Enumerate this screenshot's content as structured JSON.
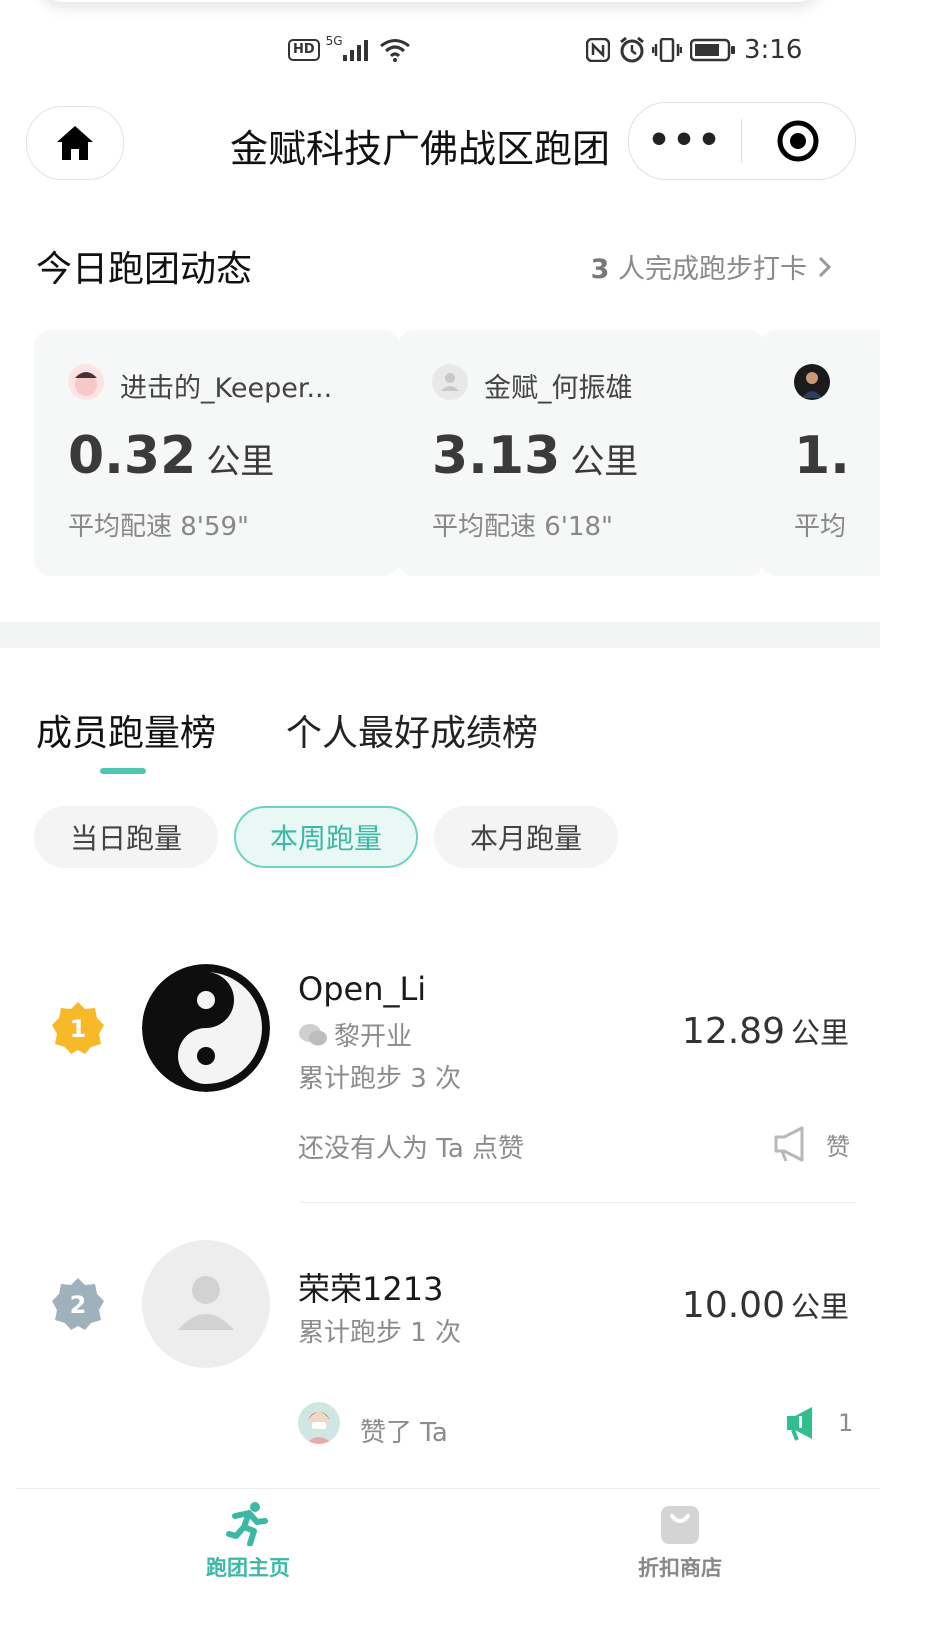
{
  "status_bar": {
    "network": "5G",
    "hd": "HD",
    "time": "3:16"
  },
  "nav": {
    "title": "金赋科技广佛战区跑团",
    "more_label": "•••"
  },
  "today": {
    "title": "今日跑团动态",
    "summary_count": "3",
    "summary_text": "人完成跑步打卡",
    "cards": [
      {
        "name": "进击的_Keeper...",
        "distance": "0.32",
        "unit": "公里",
        "pace": "平均配速 8'59\""
      },
      {
        "name": "金赋_何振雄",
        "distance": "3.13",
        "unit": "公里",
        "pace": "平均配速 6'18\""
      },
      {
        "name": "",
        "distance": "1.",
        "unit": "",
        "pace": "平均"
      }
    ]
  },
  "rank_tabs": [
    "成员跑量榜",
    "个人最好成绩榜"
  ],
  "filters": [
    "当日跑量",
    "本周跑量",
    "本月跑量"
  ],
  "ranking": [
    {
      "rank": "1",
      "name": "Open_Li",
      "wechat": "黎开业",
      "runs": "累计跑步 3 次",
      "distance": "12.89",
      "unit": "公里",
      "likes_text": "还没有人为 Ta 点赞",
      "like_label": "赞"
    },
    {
      "rank": "2",
      "name": "荣荣1213",
      "runs": "累计跑步 1 次",
      "distance": "10.00",
      "unit": "公里",
      "likes_text": "赞了 Ta",
      "like_count": "1"
    }
  ],
  "bottom_nav": [
    {
      "label": "跑团主页",
      "icon": "runner-icon",
      "active": true
    },
    {
      "label": "折扣商店",
      "icon": "shopping-bag-icon",
      "active": false
    }
  ],
  "colors": {
    "accent": "#3cb8a4",
    "gold": "#f7b928",
    "silver": "#9fb1ba"
  }
}
